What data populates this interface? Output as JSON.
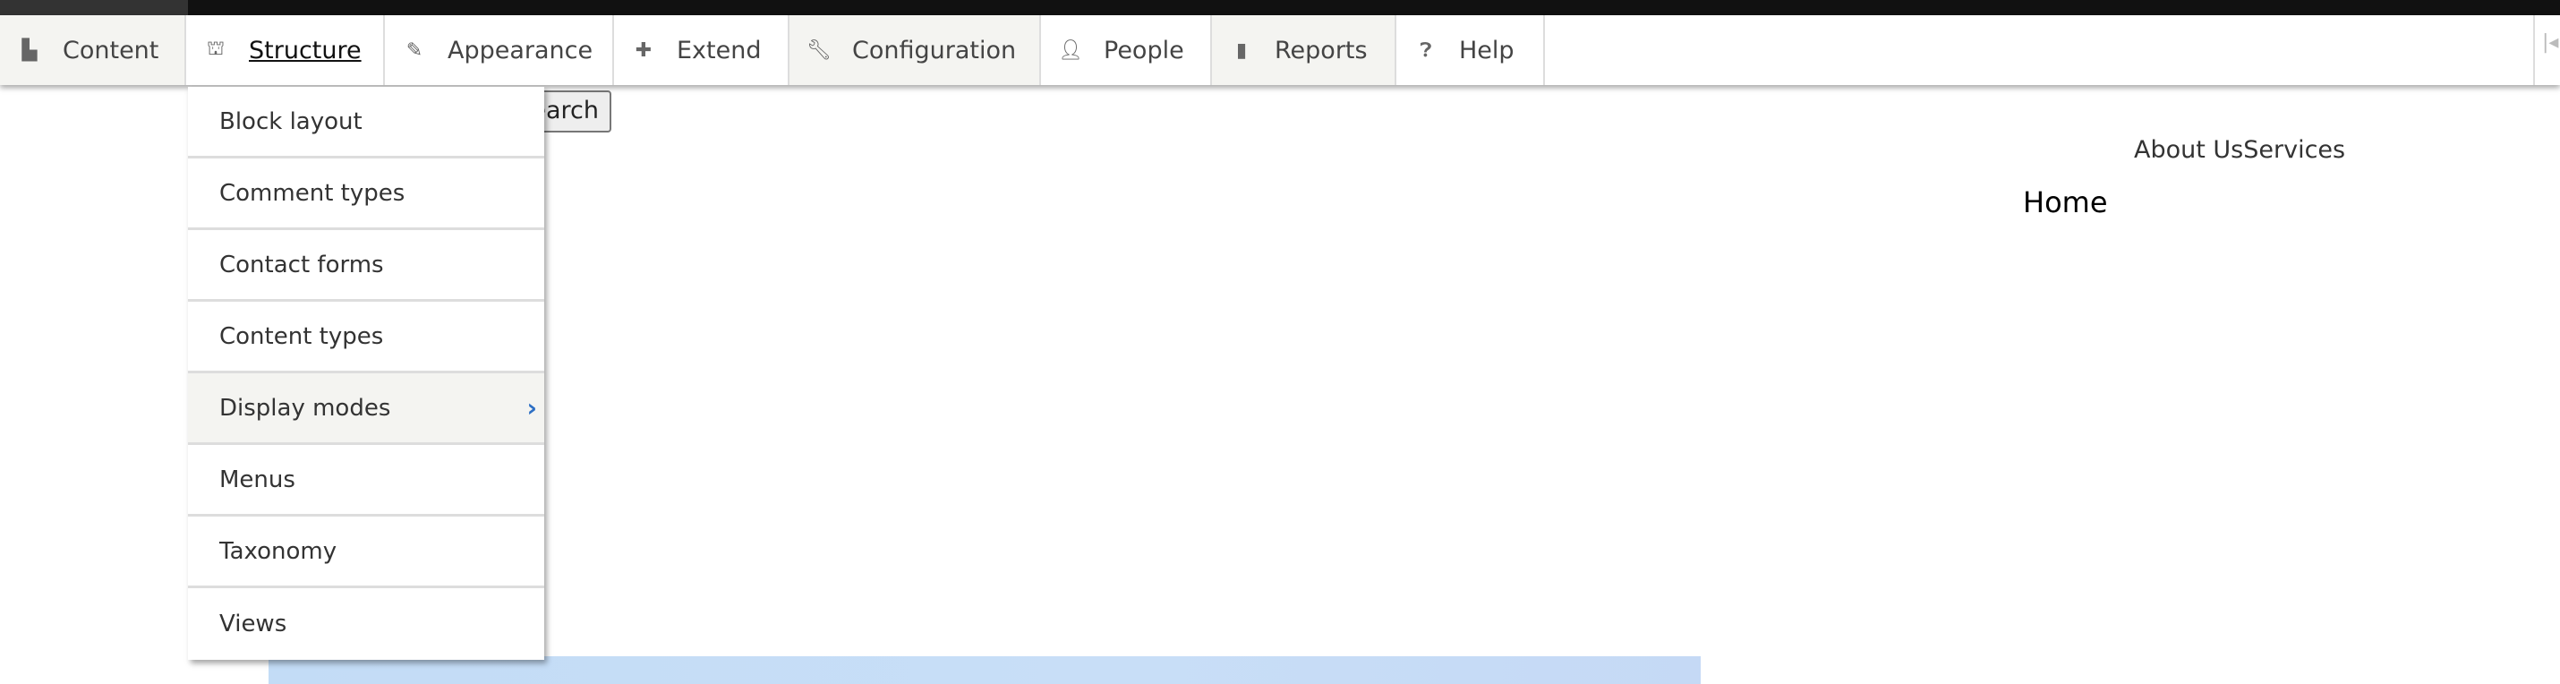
{
  "toolbar": {
    "tabs": [
      {
        "label": "Content",
        "icon": "file-icon"
      },
      {
        "label": "Structure",
        "icon": "sitemap-icon"
      },
      {
        "label": "Appearance",
        "icon": "paintbrush-icon"
      },
      {
        "label": "Extend",
        "icon": "puzzle-icon"
      },
      {
        "label": "Configuration",
        "icon": "wrench-icon"
      },
      {
        "label": "People",
        "icon": "people-icon"
      },
      {
        "label": "Reports",
        "icon": "bar-chart-icon"
      },
      {
        "label": "Help",
        "icon": "help-icon"
      }
    ]
  },
  "search_button": "Search",
  "structure_menu": {
    "items": [
      "Block layout",
      "Comment types",
      "Contact forms",
      "Content types",
      "Display modes",
      "Menus",
      "Taxonomy",
      "Views"
    ]
  },
  "page": {
    "nav_links": "About UsServices",
    "home": "Home"
  }
}
